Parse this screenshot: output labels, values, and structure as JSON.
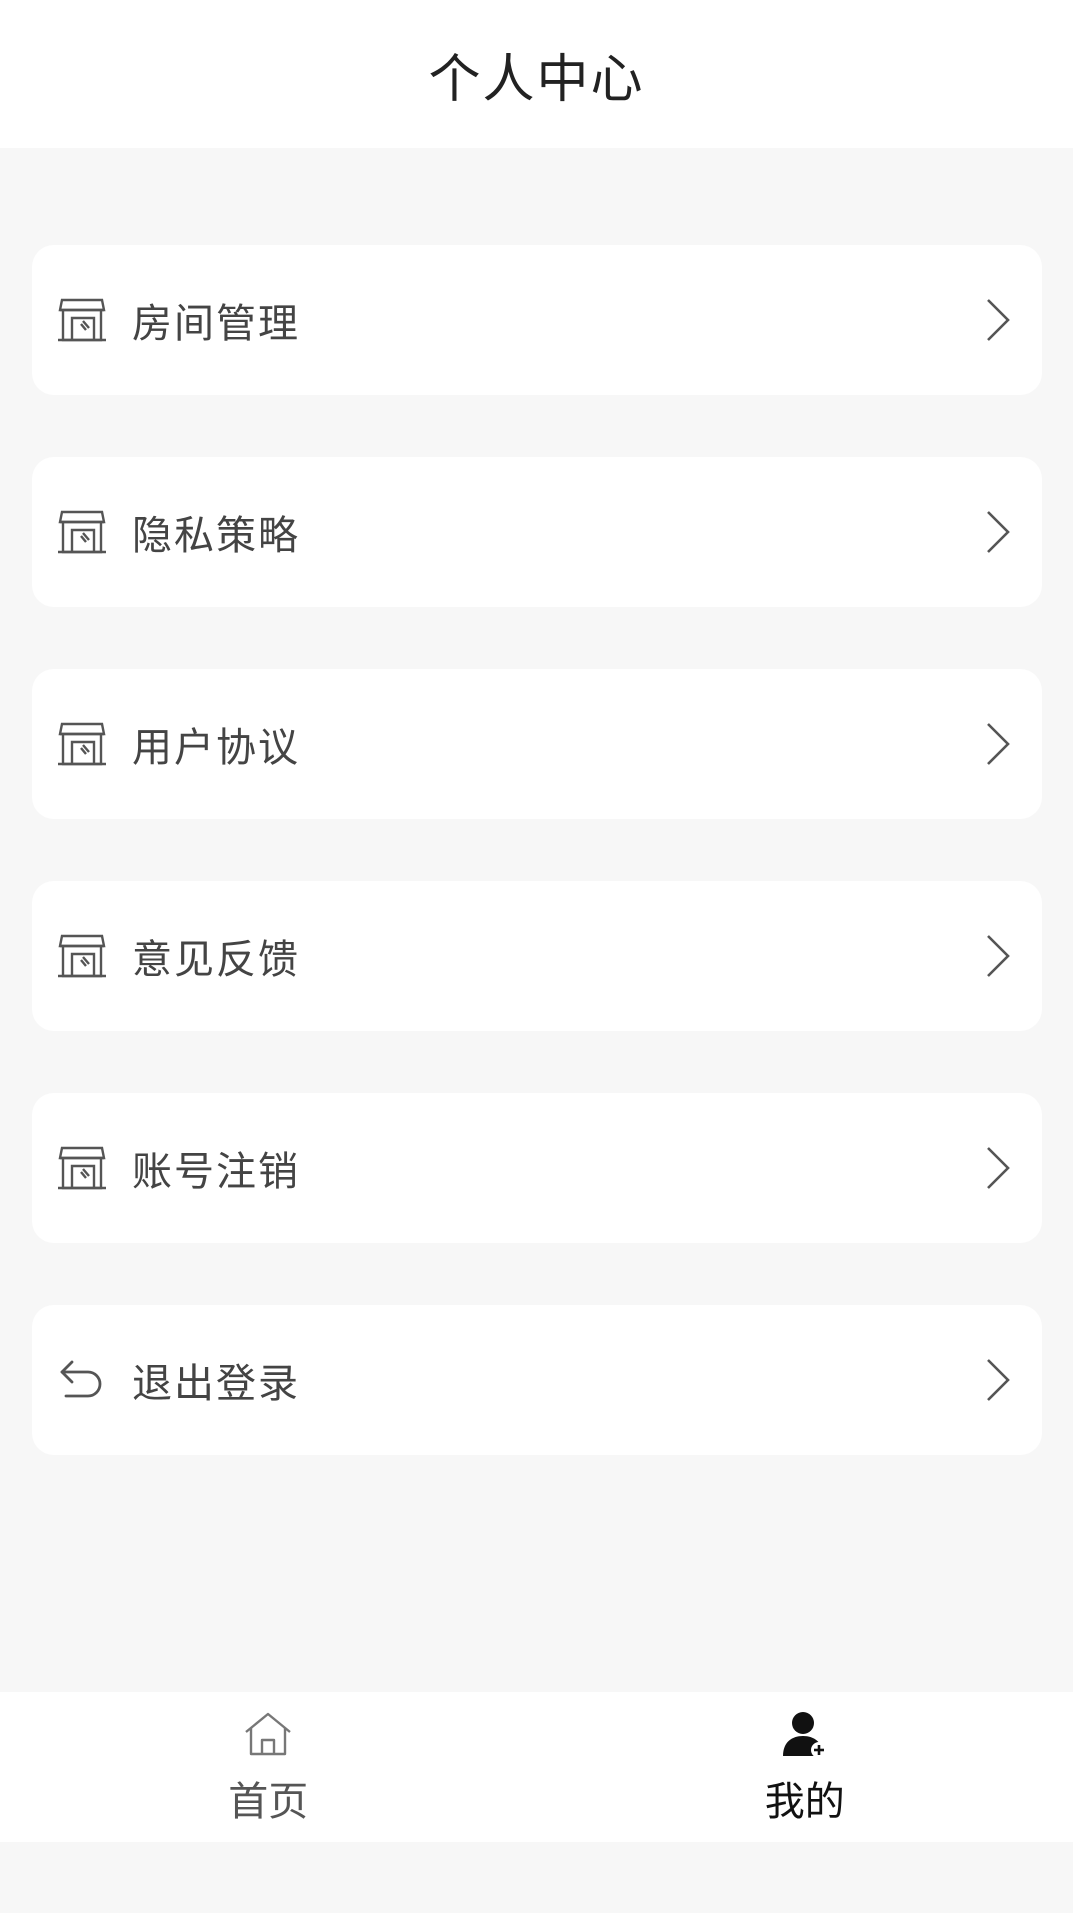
{
  "header": {
    "title": "个人中心"
  },
  "menu": {
    "items": [
      {
        "label": "房间管理",
        "icon": "store-icon"
      },
      {
        "label": "隐私策略",
        "icon": "store-icon"
      },
      {
        "label": "用户协议",
        "icon": "store-icon"
      },
      {
        "label": "意见反馈",
        "icon": "store-icon"
      },
      {
        "label": "账号注销",
        "icon": "store-icon"
      },
      {
        "label": "退出登录",
        "icon": "undo-arrow-icon"
      }
    ]
  },
  "tabbar": {
    "tabs": [
      {
        "label": "首页",
        "icon": "home-icon",
        "active": false
      },
      {
        "label": "我的",
        "icon": "user-add-icon",
        "active": true
      }
    ]
  },
  "colors": {
    "background": "#f7f7f7",
    "card": "#ffffff",
    "text": "#444444",
    "active": "#111111"
  }
}
